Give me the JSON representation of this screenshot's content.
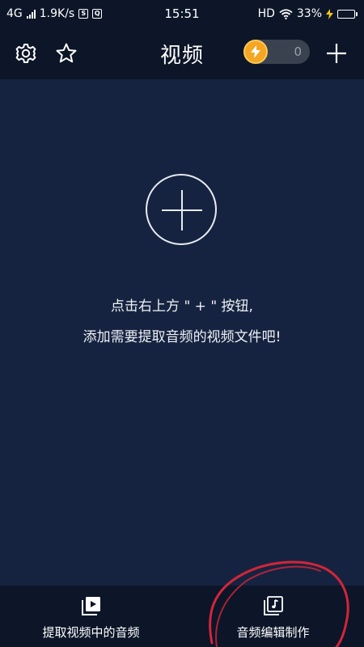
{
  "status_bar": {
    "network": "4G",
    "speed": "1.9K/s",
    "time": "15:51",
    "hd": "HD",
    "battery_percent": "33%",
    "battery_level": 0.33
  },
  "header": {
    "title": "视频",
    "coin_count": "0"
  },
  "main": {
    "hint_line1": "点击右上方 \" + \" 按钮,",
    "hint_line2": "添加需要提取音频的视频文件吧!"
  },
  "bottom_tabs": [
    {
      "label": "提取视频中的音频",
      "icon": "video-play-icon"
    },
    {
      "label": "音频编辑制作",
      "icon": "music-note-icon"
    }
  ],
  "colors": {
    "background": "#162340",
    "bar_background": "#0c1628",
    "coin": "#f5a623",
    "annotation": "#d3253a"
  }
}
